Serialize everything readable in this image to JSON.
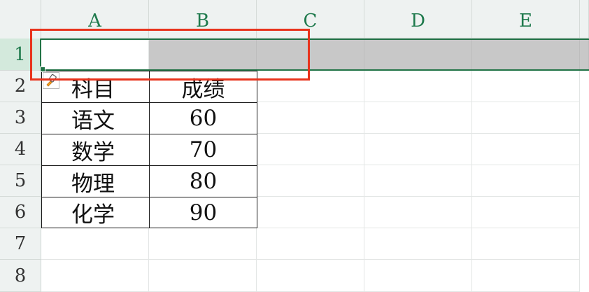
{
  "columns": [
    "A",
    "B",
    "C",
    "D",
    "E"
  ],
  "rows": [
    "1",
    "2",
    "3",
    "4",
    "5",
    "6",
    "7",
    "8"
  ],
  "table": {
    "header": {
      "subject": "科目",
      "score": "成绩"
    },
    "rows": [
      {
        "subject": "语文",
        "score": "60"
      },
      {
        "subject": "数学",
        "score": "70"
      },
      {
        "subject": "物理",
        "score": "80"
      },
      {
        "subject": "化学",
        "score": "90"
      }
    ]
  },
  "selection": {
    "row": "1",
    "active_cell": "A1"
  },
  "colors": {
    "header_green": "#1f7a4d",
    "selection_green": "#217346",
    "highlight_red": "#e8331c",
    "row_fill": "#c8c8c8"
  },
  "icons": {
    "paste_options": "paste-brush-icon"
  }
}
